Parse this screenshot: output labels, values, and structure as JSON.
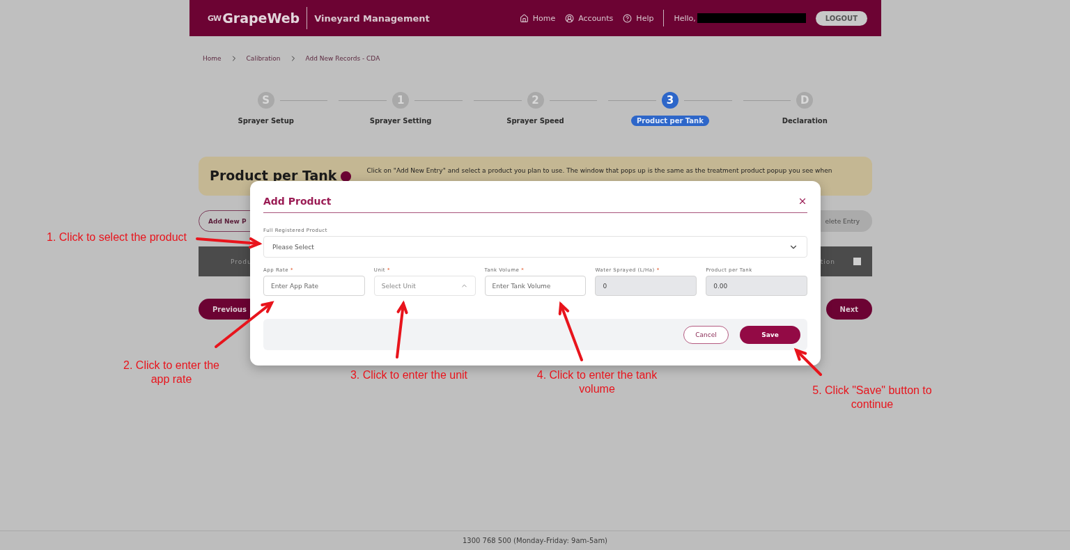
{
  "header": {
    "logo_mark": "GW",
    "logo": "GrapeWeb",
    "app_name": "Vineyard Management",
    "nav": [
      {
        "label": "Home"
      },
      {
        "label": "Accounts"
      },
      {
        "label": "Help"
      }
    ],
    "greeting": "Hello,",
    "logout": "LOGOUT"
  },
  "breadcrumb": [
    "Home",
    "Calibration",
    "Add New Records - CDA"
  ],
  "steps": [
    {
      "badge": "S",
      "label": "Sprayer Setup",
      "selected": false
    },
    {
      "badge": "1",
      "label": "Sprayer Setting",
      "selected": false
    },
    {
      "badge": "2",
      "label": "Sprayer Speed",
      "selected": false
    },
    {
      "badge": "3",
      "label": "Product per Tank",
      "selected": true
    },
    {
      "badge": "D",
      "label": "Declaration",
      "selected": false
    }
  ],
  "banner": {
    "title": "Product per Tank",
    "text": "Click on \"Add New Entry\" and select a product you plan to use. The window that pops up is the same as the treatment product popup you see when"
  },
  "actions": {
    "add": "Add New P",
    "delete": "elete Entry"
  },
  "table": {
    "columns": [
      "Produ",
      "tion"
    ],
    "select_all_checked": false
  },
  "nav_buttons": {
    "previous": "Previous",
    "next": "Next"
  },
  "modal": {
    "title": "Add Product",
    "product": {
      "label": "Full Registered Product",
      "placeholder": "Please Select"
    },
    "fields": [
      {
        "kind": "input",
        "label": "App Rate",
        "required_mark": "*",
        "placeholder": "Enter App Rate"
      },
      {
        "kind": "select",
        "label": "Unit",
        "required_mark": "*",
        "placeholder": "Select Unit"
      },
      {
        "kind": "input",
        "label": "Tank Volume",
        "required_mark": "*",
        "placeholder": "Enter Tank Volume"
      },
      {
        "kind": "readonly",
        "label": "Water Sprayed (L/Ha)",
        "required_mark": "*",
        "value": "0"
      },
      {
        "kind": "readonly",
        "label": "Product per Tank",
        "value": "0.00"
      }
    ],
    "cancel": "Cancel",
    "save": "Save"
  },
  "annotations": [
    {
      "text": "1. Click to select the product"
    },
    {
      "text": "2. Click to enter the app rate"
    },
    {
      "text": "3. Click to enter the unit"
    },
    {
      "text": "4. Click to enter the tank volume"
    },
    {
      "text": "5. Click \"Save\" button to continue"
    }
  ],
  "footer": "1300 768 500 (Monday-Friday: 9am-5am)"
}
